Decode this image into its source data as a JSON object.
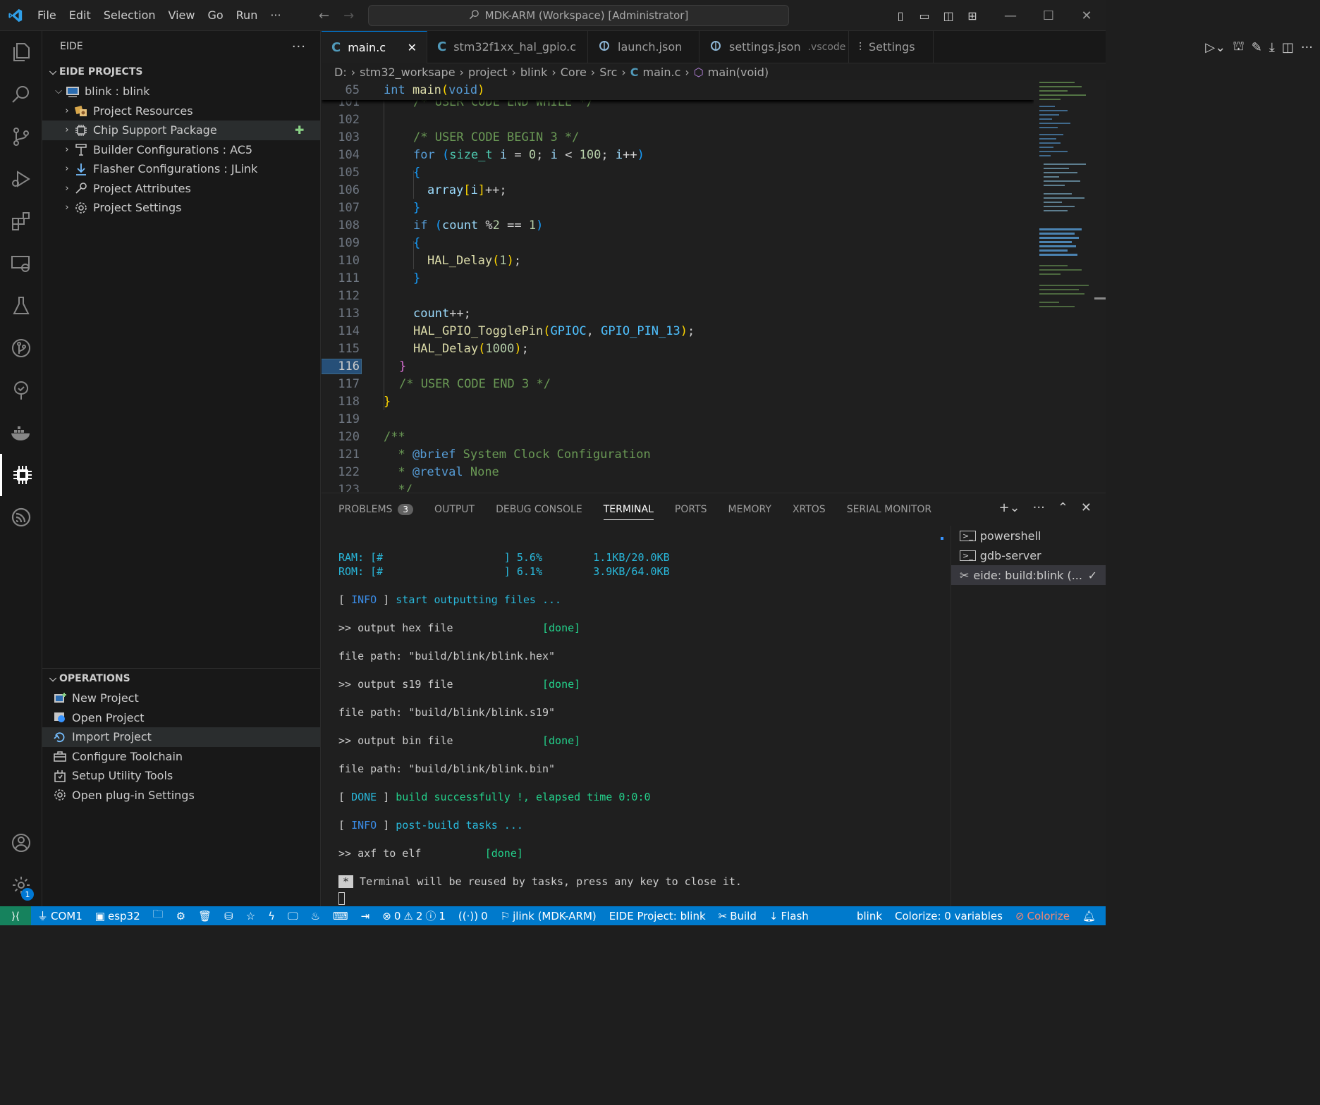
{
  "titlebar": {
    "menu": [
      "File",
      "Edit",
      "Selection",
      "View",
      "Go",
      "Run",
      "···"
    ],
    "command_center": "MDK-ARM (Workspace) [Administrator]"
  },
  "sidebar": {
    "title": "EIDE",
    "projects_section": "EIDE PROJECTS",
    "project_root": "blink : blink",
    "items": [
      {
        "label": "Project Resources",
        "icon": "resources-icon"
      },
      {
        "label": "Chip Support Package",
        "icon": "chip-icon"
      },
      {
        "label": "Builder Configurations : AC5",
        "icon": "builder-icon"
      },
      {
        "label": "Flasher Configurations : JLink",
        "icon": "flasher-icon"
      },
      {
        "label": "Project Attributes",
        "icon": "wrench-icon"
      },
      {
        "label": "Project Settings",
        "icon": "gear-icon"
      }
    ],
    "operations_section": "OPERATIONS",
    "operations": [
      {
        "label": "New Project"
      },
      {
        "label": "Open Project"
      },
      {
        "label": "Import Project"
      },
      {
        "label": "Configure Toolchain"
      },
      {
        "label": "Setup Utility Tools"
      },
      {
        "label": "Open plug-in Settings"
      }
    ]
  },
  "tabs": [
    {
      "label": "main.c",
      "icon": "C"
    },
    {
      "label": "stm32f1xx_hal_gpio.c",
      "icon": "C"
    },
    {
      "label": "launch.json",
      "icon": ""
    },
    {
      "label": "settings.json",
      "suffix": ".vscode"
    },
    {
      "label": "Settings"
    }
  ],
  "breadcrumb": [
    "D:",
    "stm32_worksape",
    "project",
    "blink",
    "Core",
    "Src",
    "main.c",
    "main(void)"
  ],
  "editor": {
    "sticky_line": "65",
    "line_numbers": [
      "101",
      "102",
      "103",
      "104",
      "105",
      "106",
      "107",
      "108",
      "109",
      "110",
      "111",
      "112",
      "113",
      "114",
      "115",
      "116",
      "117",
      "118",
      "119",
      "120",
      "121",
      "122",
      "123"
    ],
    "current_line": "116"
  },
  "panel": {
    "tabs": [
      "PROBLEMS",
      "OUTPUT",
      "DEBUG CONSOLE",
      "TERMINAL",
      "PORTS",
      "MEMORY",
      "XRTOS",
      "SERIAL MONITOR"
    ],
    "problems_count": "3",
    "terminal": {
      "ram": "RAM: [#                   ] 5.6%        1.1KB/20.0KB",
      "rom": "ROM: [#                   ] 6.1%        3.9KB/64.0KB",
      "l1_a": "[ ",
      "l1_b": "INFO",
      "l1_c": " ] ",
      "l1_d": "start outputting files ...",
      "l2_a": ">> output hex file              ",
      "l2_b": "[done]",
      "l3": "file path: \"build/blink/blink.hex\"",
      "l4_a": ">> output s19 file              ",
      "l4_b": "[done]",
      "l5": "file path: \"build/blink/blink.s19\"",
      "l6_a": ">> output bin file              ",
      "l6_b": "[done]",
      "l7": "file path: \"build/blink/blink.bin\"",
      "l8_a": "[ ",
      "l8_b": "DONE",
      "l8_c": " ] ",
      "l8_d": "build successfully !, elapsed time 0:0:0",
      "l9_a": "[ ",
      "l9_b": "INFO",
      "l9_c": " ] ",
      "l9_d": "post-build tasks ...",
      "l10_a": ">> axf to elf          ",
      "l10_b": "[done]",
      "l11_star": "*",
      "l11": " Terminal will be reused by tasks, press any key to close it."
    },
    "terminal_list": [
      "powershell",
      "gdb-server",
      "eide: build:blink (..."
    ]
  },
  "statusbar": {
    "com": "COM1",
    "esp": "esp32",
    "errors": "0",
    "warnings": "2",
    "infos": "1",
    "ports": "0",
    "jlink": "jlink (MDK-ARM)",
    "eide_project": "EIDE Project: blink",
    "build": "Build",
    "flash": "Flash",
    "blink": "blink",
    "colorize": "Colorize: 0 variables",
    "colorize_toggle": "Colorize",
    "bell_badge": "1"
  },
  "colors": {
    "accent": "#007acc",
    "remote": "#16825d",
    "c_icon": "#519aba"
  }
}
